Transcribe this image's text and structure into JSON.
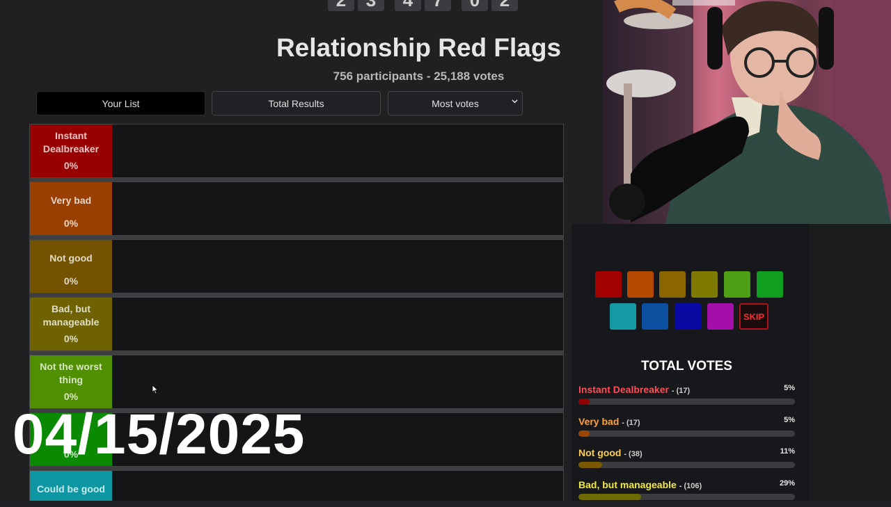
{
  "digits": [
    "2",
    "3",
    "4",
    "7",
    "0",
    "2"
  ],
  "header": {
    "title": "Relationship Red Flags",
    "subtitle": "756 participants - 25,188 votes"
  },
  "tabs": {
    "your_list": "Your List",
    "total_results": "Total Results"
  },
  "sort": {
    "selected": "Most votes"
  },
  "tiers": [
    {
      "name": "Instant Dealbreaker",
      "pct": "0%",
      "color": "#990000"
    },
    {
      "name": "Very bad",
      "pct": "0%",
      "color": "#994000"
    },
    {
      "name": "Not good",
      "pct": "0%",
      "color": "#735300"
    },
    {
      "name": "Bad, but manageable",
      "pct": "0%",
      "color": "#6e6300"
    },
    {
      "name": "Not the worst thing",
      "pct": "0%",
      "color": "#4f8f00"
    },
    {
      "name": "",
      "pct": "0%",
      "color": "#0a8a00"
    },
    {
      "name": "Could be good",
      "pct": "",
      "color": "#0e97a3"
    }
  ],
  "overlay_date": "04/15/2025",
  "palette": {
    "colors": [
      "#a30000",
      "#b34a00",
      "#8a6500",
      "#7e7a00",
      "#4e9e15",
      "#0f9e1f",
      "#159aa3",
      "#0c4f9e",
      "#0a0aa3",
      "#a30fa8"
    ],
    "skip_label": "SKIP"
  },
  "total_votes": {
    "title": "TOTAL VOTES",
    "rows": [
      {
        "label": "Instant Dealbreaker",
        "count": "(17)",
        "pct": "5%",
        "value": 0.05,
        "color": "#ff4d57",
        "bar": "#8f0000"
      },
      {
        "label": "Very bad",
        "count": "(17)",
        "pct": "5%",
        "value": 0.05,
        "color": "#ffa13d",
        "bar": "#9a4500"
      },
      {
        "label": "Not good",
        "count": "(38)",
        "pct": "11%",
        "value": 0.11,
        "color": "#ffcf4d",
        "bar": "#7a5800"
      },
      {
        "label": "Bad, but manageable",
        "count": "(106)",
        "pct": "29%",
        "value": 0.29,
        "color": "#f3ea3a",
        "bar": "#6f6a00"
      }
    ]
  }
}
